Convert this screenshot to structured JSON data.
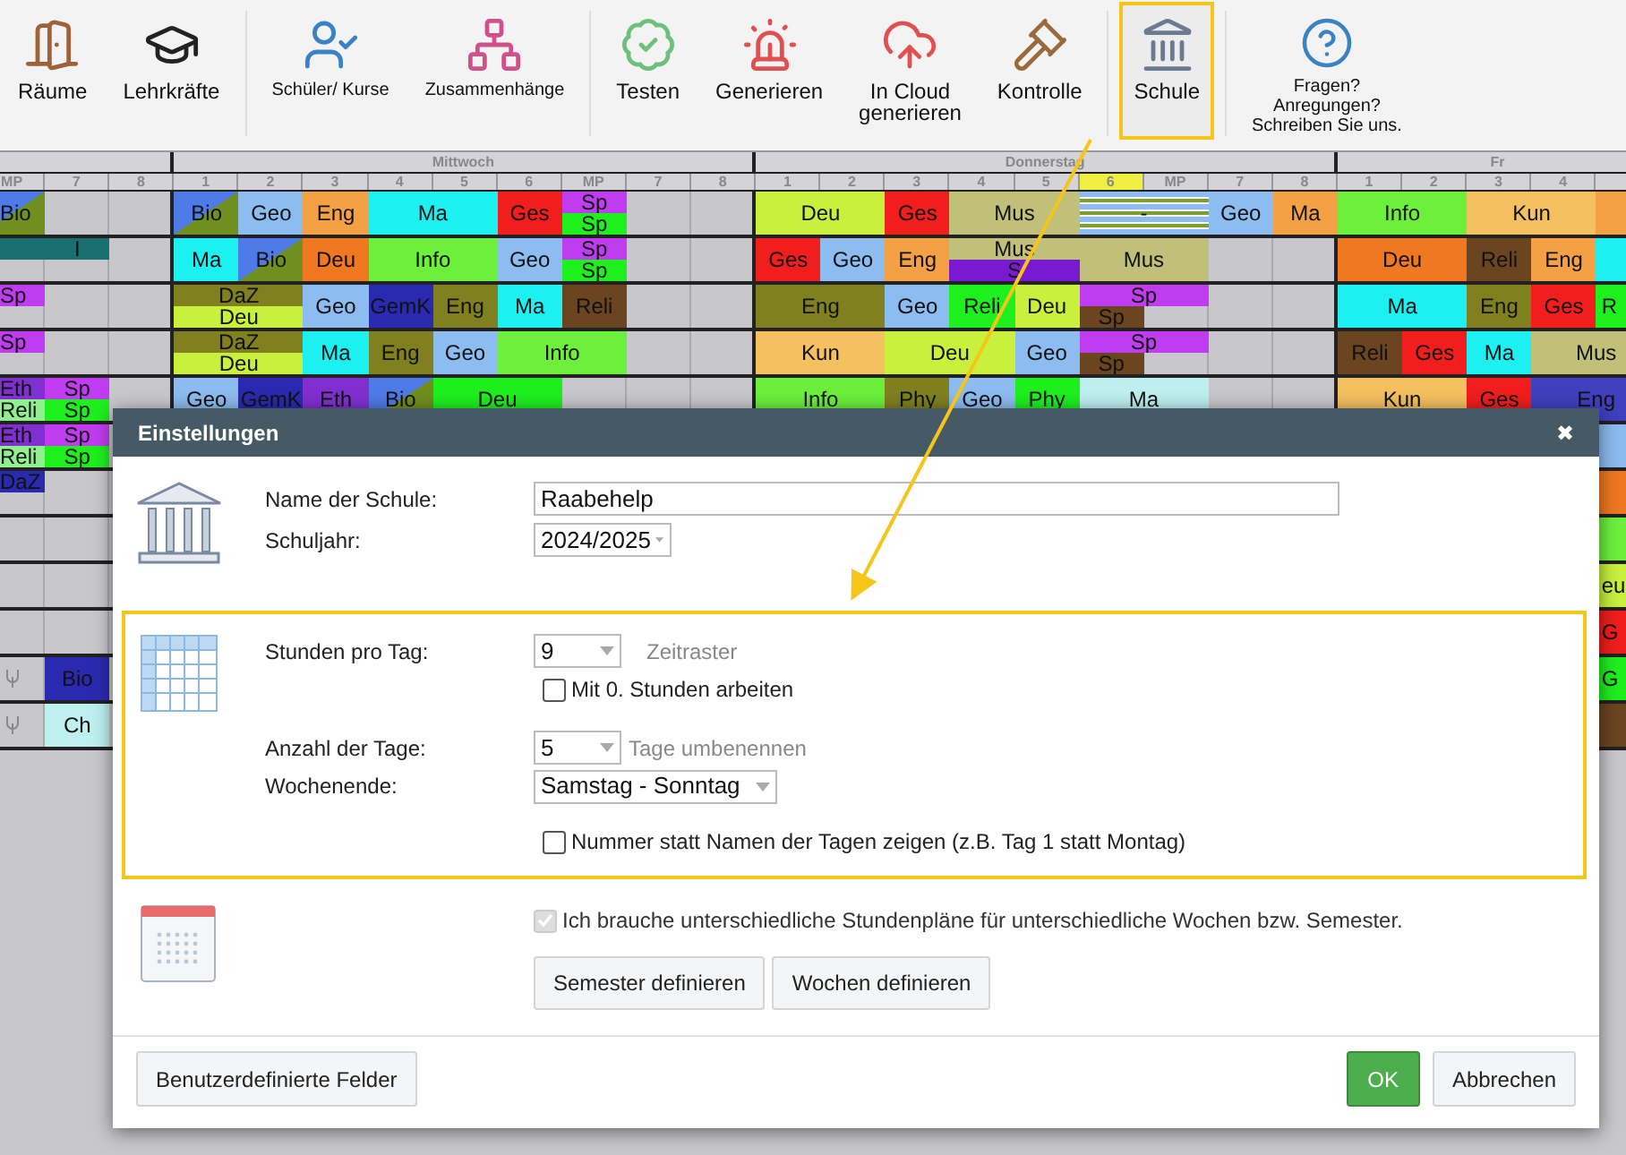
{
  "toolbar": {
    "groups": [
      [
        {
          "label": [
            "Räume"
          ],
          "kind": "large",
          "selected": false
        },
        {
          "label": [
            "Lehrkräfte"
          ],
          "kind": "large",
          "selected": false
        }
      ],
      [
        {
          "label": [
            "Schüler/ Kurse"
          ],
          "kind": "small",
          "selected": false
        },
        {
          "label": [
            "Zusammenhänge"
          ],
          "kind": "small",
          "selected": false
        }
      ],
      [
        {
          "label": [
            "Testen"
          ],
          "kind": "large",
          "selected": false
        },
        {
          "label": [
            "Generieren"
          ],
          "kind": "large",
          "selected": false
        },
        {
          "label": [
            "In Cloud",
            "generieren"
          ],
          "kind": "large",
          "selected": false
        },
        {
          "label": [
            "Kontrolle"
          ],
          "kind": "large",
          "selected": false
        }
      ],
      [
        {
          "label": [
            "Schule"
          ],
          "kind": "large",
          "selected": true
        }
      ],
      [
        {
          "label": [
            "Fragen?",
            "Anregungen?",
            "Schreiben Sie uns."
          ],
          "kind": "small",
          "selected": false
        }
      ]
    ]
  },
  "timetable": {
    "days": [
      {
        "label": "Mittwoch"
      },
      {
        "label": "Donnerstag"
      },
      {
        "label": "Fr"
      }
    ],
    "periods": [
      {
        "label": "MP",
        "selected": false
      },
      {
        "label": "7",
        "selected": false
      },
      {
        "label": "8",
        "selected": false
      },
      {
        "label": "1",
        "selected": false
      },
      {
        "label": "2",
        "selected": false
      },
      {
        "label": "3",
        "selected": false
      },
      {
        "label": "4",
        "selected": false
      },
      {
        "label": "5",
        "selected": false
      },
      {
        "label": "6",
        "selected": false
      },
      {
        "label": "MP",
        "selected": false
      },
      {
        "label": "7",
        "selected": false
      },
      {
        "label": "8",
        "selected": false
      },
      {
        "label": "1",
        "selected": false
      },
      {
        "label": "2",
        "selected": false
      },
      {
        "label": "3",
        "selected": false
      },
      {
        "label": "4",
        "selected": false
      },
      {
        "label": "5",
        "selected": false
      },
      {
        "label": "6",
        "selected": true
      },
      {
        "label": "MP",
        "selected": false
      },
      {
        "label": "7",
        "selected": false
      },
      {
        "label": "8",
        "selected": false
      },
      {
        "label": "1",
        "selected": false
      },
      {
        "label": "2",
        "selected": false
      },
      {
        "label": "3",
        "selected": false
      },
      {
        "label": "4",
        "selected": false
      }
    ],
    "rows": [
      {
        "cells": [
          {
            "kind": "diagonal",
            "label": "Bio",
            "color": "#4f7be8"
          },
          "",
          "",
          {
            "kind": "diagonal",
            "label": "Bio",
            "color": "#4f7be8"
          },
          {
            "kind": "plain",
            "label": "Geo",
            "color": "#8cbcf0"
          },
          {
            "kind": "plain",
            "label": "Eng",
            "color": "#f4a045"
          },
          {
            "kind": "plain",
            "label": "Ma",
            "color": "#1df0f0"
          },
          "",
          {
            "kind": "plain",
            "label": "Ges",
            "color": "#f21d1d"
          },
          {
            "kind": "split",
            "parts": [
              {
                "label": "Sp",
                "color": "#c03cf0"
              },
              {
                "label": "Sp",
                "color": "#1ef01e"
              }
            ]
          },
          "",
          "",
          {
            "kind": "plain",
            "label": "Deu",
            "color": "#c8f03c"
          },
          "",
          {
            "kind": "plain",
            "label": "Ges",
            "color": "#f21d1d"
          },
          {
            "kind": "plain",
            "label": "Mus",
            "color": "#c0c07a"
          },
          "",
          {
            "kind": "striped",
            "label": "-",
            "color": "#8cbcf0"
          },
          "",
          {
            "kind": "plain",
            "label": "Geo",
            "color": "#8cbcf0"
          },
          {
            "kind": "plain",
            "label": "Ma",
            "color": "#f4a045"
          },
          {
            "kind": "plain",
            "label": "Info",
            "color": "#6cf03c"
          },
          "",
          {
            "kind": "plain",
            "label": "Kun",
            "color": "#f4c060"
          },
          "",
          {
            "kind": "plain",
            "color": "#f4a045"
          }
        ]
      },
      {
        "cells": [
          {
            "kind": "split",
            "parts": [
              {
                "color": "#1a7070"
              }
            ]
          },
          {
            "kind": "split",
            "parts": [
              {
                "label": "I",
                "color": "#1a7070"
              }
            ]
          },
          "",
          {
            "kind": "plain",
            "label": "Ma",
            "color": "#1df0f0"
          },
          {
            "kind": "diagonal",
            "label": "Bio",
            "color": "#4f7be8"
          },
          {
            "kind": "plain",
            "label": "Deu",
            "color": "#f07820"
          },
          {
            "kind": "plain",
            "label": "Info",
            "color": "#6cf03c"
          },
          "",
          {
            "kind": "plain",
            "label": "Geo",
            "color": "#8cbcf0"
          },
          {
            "kind": "split",
            "parts": [
              {
                "label": "Sp",
                "color": "#c03cf0"
              },
              {
                "label": "Sp",
                "color": "#1ef01e"
              }
            ]
          },
          "",
          "",
          {
            "kind": "plain",
            "label": "Ges",
            "color": "#f21d1d"
          },
          {
            "kind": "plain",
            "label": "Geo",
            "color": "#8cbcf0"
          },
          {
            "kind": "plain",
            "label": "Eng",
            "color": "#f4a045"
          },
          {
            "kind": "split",
            "parts": [
              {
                "label": "Mus",
                "color": "#c0c07a"
              },
              {
                "label": "S",
                "color": "#7a1ad0"
              }
            ]
          },
          "",
          {
            "kind": "plain",
            "label": "Mus",
            "color": "#c0c07a"
          },
          "",
          "",
          "",
          {
            "kind": "plain",
            "label": "Deu",
            "color": "#f07820"
          },
          "",
          {
            "kind": "plain",
            "label": "Reli",
            "color": "#6b4420"
          },
          {
            "kind": "plain",
            "label": "Eng",
            "color": "#f4a045"
          },
          {
            "kind": "plain",
            "color": "#1df0f0"
          }
        ]
      },
      {
        "cells": [
          {
            "kind": "split",
            "parts": [
              {
                "label": "Sp",
                "color": "#c03cf0"
              }
            ]
          },
          "",
          "",
          {
            "kind": "split",
            "parts": [
              {
                "label": "DaZ",
                "color": "#808020"
              },
              {
                "label": "Deu",
                "color": "#c8f03c"
              }
            ]
          },
          "",
          {
            "kind": "plain",
            "label": "Geo",
            "color": "#8cbcf0"
          },
          {
            "kind": "plain",
            "label": "GemK",
            "color": "#2a2ab0"
          },
          {
            "kind": "plain",
            "label": "Eng",
            "color": "#808020"
          },
          {
            "kind": "plain",
            "label": "Ma",
            "color": "#1df0f0"
          },
          {
            "kind": "plain",
            "label": "Reli",
            "color": "#6b4420"
          },
          "",
          "",
          {
            "kind": "plain",
            "label": "Eng",
            "color": "#808020"
          },
          "",
          {
            "kind": "plain",
            "label": "Geo",
            "color": "#8cbcf0"
          },
          {
            "kind": "plain",
            "label": "Reli",
            "color": "#1ef01e"
          },
          {
            "kind": "plain",
            "label": "Deu",
            "color": "#c8f03c"
          },
          {
            "kind": "split_narrow",
            "parts": [
              {
                "label": "Sp",
                "color": "#c03cf0"
              },
              {
                "label": "Sp",
                "color": "#6b4420"
              }
            ]
          },
          "",
          "",
          "",
          {
            "kind": "plain",
            "label": "Ma",
            "color": "#1df0f0"
          },
          "",
          {
            "kind": "plain",
            "label": "Eng",
            "color": "#808020"
          },
          {
            "kind": "plain",
            "label": "Ges",
            "color": "#f21d1d"
          },
          {
            "kind": "plain",
            "label": "R",
            "color": "#1ef01e"
          }
        ]
      },
      {
        "cells": [
          {
            "kind": "split",
            "parts": [
              {
                "label": "Sp",
                "color": "#c03cf0"
              }
            ]
          },
          "",
          "",
          {
            "kind": "split",
            "parts": [
              {
                "label": "DaZ",
                "color": "#808020"
              },
              {
                "label": "Deu",
                "color": "#c8f03c"
              }
            ]
          },
          "",
          {
            "kind": "plain",
            "label": "Ma",
            "color": "#1df0f0"
          },
          {
            "kind": "plain",
            "label": "Eng",
            "color": "#808020"
          },
          {
            "kind": "plain",
            "label": "Geo",
            "color": "#8cbcf0"
          },
          {
            "kind": "plain",
            "label": "Info",
            "color": "#6cf03c"
          },
          "",
          "",
          "",
          {
            "kind": "plain",
            "label": "Kun",
            "color": "#f4c060"
          },
          "",
          {
            "kind": "plain",
            "label": "Deu",
            "color": "#c8f03c"
          },
          "",
          {
            "kind": "plain",
            "label": "Geo",
            "color": "#8cbcf0"
          },
          {
            "kind": "split_narrow",
            "parts": [
              {
                "label": "Sp",
                "color": "#c03cf0"
              },
              {
                "label": "Sp",
                "color": "#6b4420"
              }
            ]
          },
          "",
          "",
          "",
          {
            "kind": "plain",
            "label": "Reli",
            "color": "#6b4420"
          },
          {
            "kind": "plain",
            "label": "Ges",
            "color": "#f21d1d"
          },
          {
            "kind": "plain",
            "label": "Ma",
            "color": "#1df0f0"
          },
          {
            "kind": "plain",
            "label": "Mus",
            "color": "#c0c07a"
          },
          ""
        ]
      },
      {
        "cells": [
          {
            "kind": "split",
            "parts": [
              {
                "label": "Eth",
                "color": "#8030d0"
              },
              {
                "label": "Reli",
                "color": "#90f090"
              }
            ]
          },
          {
            "kind": "split",
            "parts": [
              {
                "label": "Sp",
                "color": "#c03cf0"
              },
              {
                "label": "Sp",
                "color": "#1ef01e"
              }
            ]
          },
          "",
          {
            "kind": "plain",
            "label": "Geo",
            "color": "#8cbcf0"
          },
          {
            "kind": "plain",
            "label": "GemK",
            "color": "#2a2ab0"
          },
          {
            "kind": "plain",
            "label": "Eth",
            "color": "#8030d0"
          },
          {
            "kind": "diagonal",
            "label": "Bio",
            "color": "#4f7be8"
          },
          {
            "kind": "plain",
            "label": "Deu",
            "color": "#1ef01e"
          },
          "",
          "",
          "",
          "",
          {
            "kind": "plain",
            "label": "Info",
            "color": "#6cf03c"
          },
          "",
          {
            "kind": "plain",
            "label": "Phy",
            "color": "#808020"
          },
          {
            "kind": "plain",
            "label": "Geo",
            "color": "#8cbcf0"
          },
          {
            "kind": "plain",
            "label": "Phy",
            "color": "#1ef01e"
          },
          {
            "kind": "plain",
            "label": "Ma",
            "color": "#bef0f0"
          },
          "",
          "",
          "",
          {
            "kind": "plain",
            "label": "Kun",
            "color": "#f4c060"
          },
          "",
          {
            "kind": "plain",
            "label": "Ges",
            "color": "#f21d1d"
          },
          {
            "kind": "plain",
            "label": "Eng",
            "color": "#4040c0"
          },
          ""
        ]
      },
      {
        "cells": [
          {
            "kind": "split",
            "parts": [
              {
                "label": "Eth",
                "color": "#8030d0"
              },
              {
                "label": "Reli",
                "color": "#90f090"
              }
            ]
          },
          {
            "kind": "split",
            "parts": [
              {
                "label": "Sp",
                "color": "#c03cf0"
              },
              {
                "label": "Sp",
                "color": "#1ef01e"
              }
            ]
          },
          "",
          "",
          "",
          "",
          "",
          "",
          "",
          "",
          "",
          "",
          "",
          "",
          "",
          "",
          "",
          "",
          "",
          "",
          "",
          "",
          "",
          "",
          "",
          {
            "kind": "plain",
            "color": "#8cbcf0"
          }
        ]
      },
      {
        "cells": [
          {
            "kind": "split",
            "parts": [
              {
                "label": "DaZ",
                "color": "#2a2ab0"
              }
            ]
          },
          "",
          "",
          "",
          "",
          "",
          "",
          "",
          "",
          "",
          "",
          "",
          "",
          "",
          "",
          "",
          "",
          "",
          "",
          "",
          "",
          "",
          "",
          "",
          "",
          {
            "kind": "plain",
            "color": "#f07820"
          }
        ]
      },
      {
        "cells": [
          "",
          "",
          "",
          "",
          "",
          "",
          "",
          "",
          "",
          "",
          "",
          "",
          "",
          "",
          "",
          "",
          "",
          "",
          "",
          "",
          "",
          "",
          "",
          "",
          "",
          {
            "kind": "plain",
            "color": "#6cf03c"
          }
        ]
      },
      {
        "cells": [
          "",
          "",
          "",
          "",
          "",
          "",
          "",
          "",
          "",
          "",
          "",
          "",
          "",
          "",
          "",
          "",
          "",
          "",
          "",
          "",
          "",
          "",
          "",
          "",
          "",
          {
            "kind": "plain",
            "label": "eu",
            "color": "#c8f03c"
          }
        ]
      },
      {
        "cells": [
          "",
          "",
          "",
          "",
          "",
          "",
          "",
          "",
          "",
          "",
          "",
          "",
          "",
          "",
          "",
          "",
          "",
          "",
          "",
          "",
          "",
          "",
          "",
          "",
          "",
          {
            "kind": "plain",
            "label": "G",
            "color": "#f21d1d"
          }
        ]
      },
      {
        "cells": [
          {
            "kind": "icon"
          },
          {
            "kind": "plain",
            "label": "Bio",
            "color": "#2a2ab0"
          },
          "",
          "",
          "",
          "",
          "",
          "",
          "",
          "",
          "",
          "",
          "",
          "",
          "",
          "",
          "",
          "",
          "",
          "",
          "",
          "",
          "",
          "",
          "",
          {
            "kind": "plain",
            "label": "G",
            "color": "#1ef01e"
          }
        ]
      },
      {
        "cells": [
          {
            "kind": "icon"
          },
          {
            "kind": "plain",
            "label": "Ch",
            "color": "#bef0f0"
          },
          "",
          "",
          "",
          "",
          "",
          "",
          "",
          "",
          "",
          "",
          "",
          "",
          "",
          "",
          "",
          "",
          "",
          "",
          "",
          "",
          "",
          "",
          "",
          {
            "kind": "plain",
            "color": "#6b4420"
          }
        ]
      }
    ]
  },
  "dialog": {
    "title": "Einstellungen",
    "close": "✖",
    "school": {
      "name_label": "Name der Schule:",
      "name_value": "Raabehelp",
      "year_label": "Schuljahr:",
      "year_value": "2024/2025"
    },
    "grid_section": {
      "highlighted": true,
      "hours_label": "Stunden pro Tag:",
      "hours_value": "9",
      "time_grid_link": "Zeitraster",
      "zero_hours": {
        "label": "Mit 0. Stunden arbeiten",
        "checked": false
      },
      "days_label": "Anzahl der Tage:",
      "days_value": "5",
      "rename_link": "Tage umbenennen",
      "weekend_label": "Wochenende:",
      "weekend_value": "Samstag - Sonntag",
      "numbers": {
        "label": "Nummer statt Namen der Tagen zeigen (z.B. Tag 1 statt Montag)",
        "checked": false
      }
    },
    "weeks_section": {
      "different": {
        "label": "Ich brauche unterschiedliche Stundenpläne für unterschiedliche Wochen bzw. Semester.",
        "checked": true,
        "disabled": true
      },
      "buttons": [
        "Semester definieren",
        "Wochen definieren"
      ]
    },
    "footer": {
      "custom_fields": "Benutzerdefinierte Felder",
      "ok": "OK",
      "cancel": "Abbrechen"
    }
  }
}
